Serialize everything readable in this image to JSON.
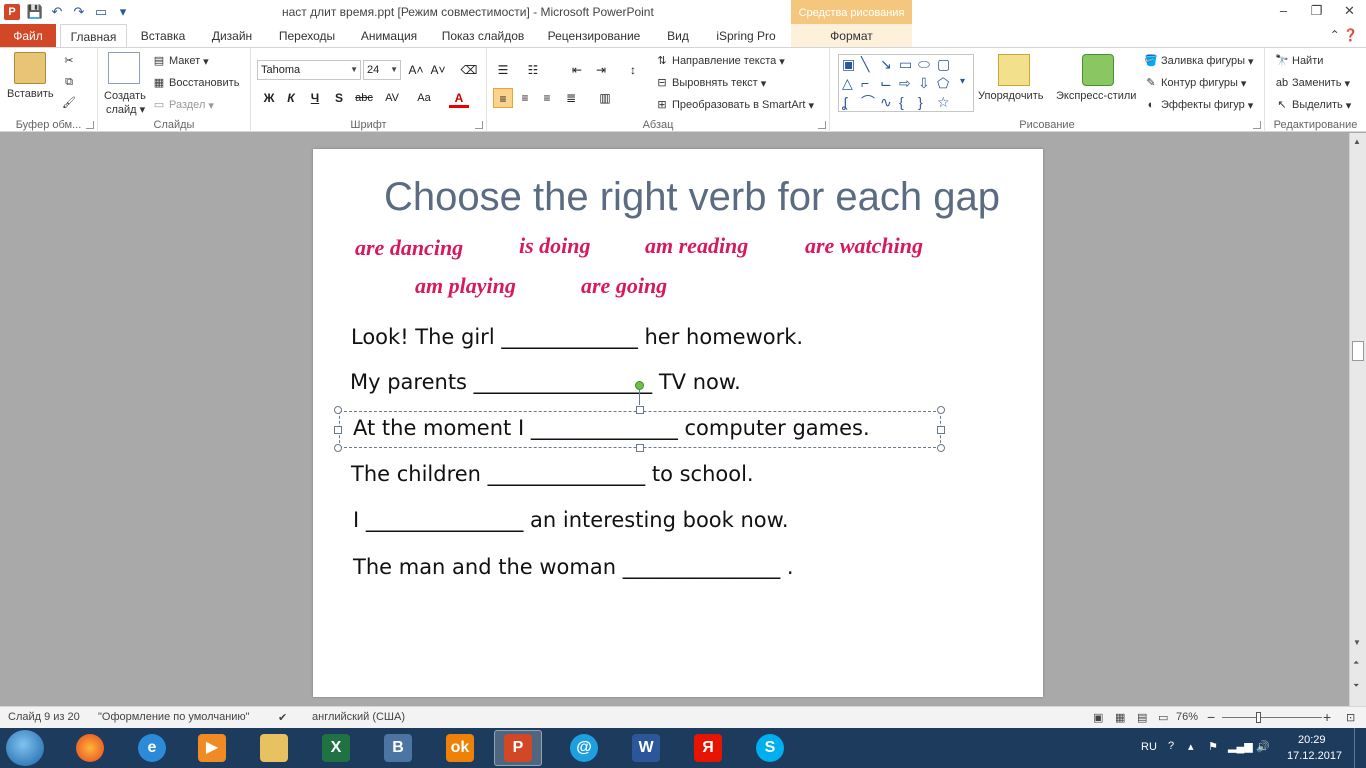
{
  "window": {
    "title": "наст длит время.ppt [Режим совместимости]  -  Microsoft PowerPoint",
    "context_group": "Средства рисования",
    "controls": {
      "minimize": "–",
      "restore": "❐",
      "close": "✕"
    }
  },
  "tabs": {
    "file": "Файл",
    "items": [
      "Главная",
      "Вставка",
      "Дизайн",
      "Переходы",
      "Анимация",
      "Показ слайдов",
      "Рецензирование",
      "Вид",
      "iSpring Pro",
      "Формат"
    ],
    "active": "Главная"
  },
  "ribbon": {
    "clipboard": {
      "label": "Буфер обм...",
      "paste": "Вставить"
    },
    "slides": {
      "label": "Слайды",
      "new_slide_1": "Создать",
      "new_slide_2": "слайд",
      "layout": "Макет",
      "reset": "Восстановить",
      "section": "Раздел"
    },
    "font": {
      "label": "Шрифт",
      "font_name": "Tahoma",
      "font_size": "24",
      "bold": "Ж",
      "italic": "К",
      "underline": "Ч",
      "shadow": "S",
      "strike": "abc",
      "spacing": "AV",
      "case": "Aa",
      "color": "A"
    },
    "paragraph": {
      "label": "Абзац",
      "text_direction": "Направление текста",
      "align_text": "Выровнять текст",
      "smartart": "Преобразовать в SmartArt"
    },
    "drawing": {
      "label": "Рисование",
      "arrange": "Упорядочить",
      "quick_styles": "Экспресс-стили",
      "fill": "Заливка фигуры",
      "outline": "Контур фигуры",
      "effects": "Эффекты фигур"
    },
    "editing": {
      "label": "Редактирование",
      "find": "Найти",
      "replace": "Заменить",
      "select": "Выделить"
    }
  },
  "slide": {
    "title": "Choose the right verb for each gap",
    "verbs_row1": [
      "are dancing",
      "is doing",
      "am reading",
      "are watching"
    ],
    "verbs_row2": [
      "am playing",
      "are going"
    ],
    "sentences": [
      "Look! The girl _____________  her homework.",
      "My parents _________________  TV now.",
      "At the moment I ______________  computer games.",
      "The children _______________  to school.",
      "I _______________  an interesting book now.",
      "The man and the woman _______________  ."
    ]
  },
  "status": {
    "slide_info": "Слайд 9 из 20",
    "theme": "\"Оформление по умолчанию\"",
    "language": "английский (США)",
    "zoom": "76%",
    "zoom_minus": "−",
    "zoom_plus": "+"
  },
  "taskbar": {
    "lang": "RU",
    "time": "20:29",
    "date": "17.12.2017",
    "apps": [
      "firefox-icon",
      "ie-icon",
      "media-player-icon",
      "explorer-icon",
      "excel-icon",
      "vk-icon",
      "odnoklassniki-icon",
      "powerpoint-icon",
      "mail-icon",
      "word-icon",
      "yandex-icon",
      "skype-icon"
    ]
  },
  "colors": {
    "accent": "#d24726",
    "verb": "#d8195e",
    "title": "#5b6b82",
    "taskbar": "#1d3b5c"
  }
}
